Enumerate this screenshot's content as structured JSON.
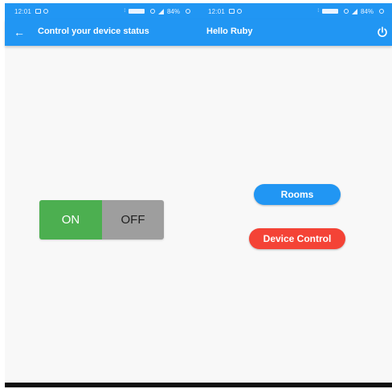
{
  "colors": {
    "primary": "#2196F3",
    "on": "#4CAF50",
    "off": "#9e9e9e",
    "danger": "#F44336",
    "background": "#f8f8f8"
  },
  "status_bar": {
    "left": {
      "time": "12:01",
      "battery": "84%"
    },
    "right": {
      "time": "12:01",
      "battery": "84%"
    }
  },
  "app_bar": {
    "back_icon": "arrow-left-icon",
    "title_left": "Control your device status",
    "title_right": "Hello Ruby",
    "action_icon": "power-icon"
  },
  "toggle": {
    "on_label": "ON",
    "off_label": "OFF",
    "selected": "ON"
  },
  "buttons": {
    "rooms": "Rooms",
    "device_control": "Device Control"
  }
}
